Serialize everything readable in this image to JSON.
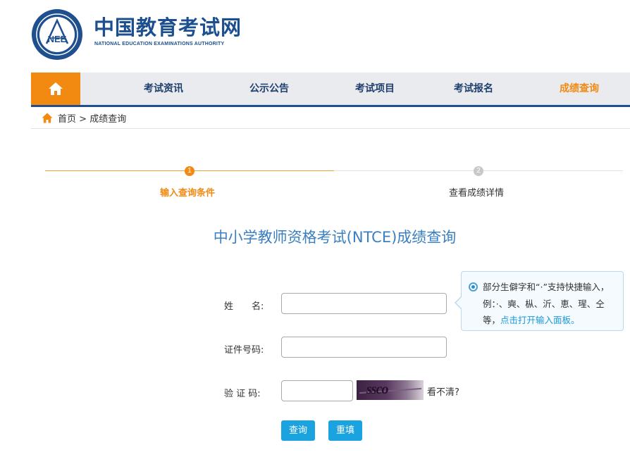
{
  "header": {
    "logo_mark_text": "NEE",
    "title": "中国教育考试网",
    "subtitle": "NATIONAL EDUCATION EXAMINATIONS AUTHORITY"
  },
  "nav": {
    "home_icon": "home-icon",
    "items": [
      {
        "label": "考试资讯"
      },
      {
        "label": "公示公告"
      },
      {
        "label": "考试项目"
      },
      {
        "label": "考试报名"
      },
      {
        "label": "成绩查询",
        "active": true
      }
    ]
  },
  "breadcrumb": {
    "home": "首页",
    "separator": ">",
    "current": "成绩查询"
  },
  "steps": [
    {
      "number": "1",
      "label": "输入查询条件",
      "active": true
    },
    {
      "number": "2",
      "label": "查看成绩详情",
      "active": false
    }
  ],
  "page_title": "中小学教师资格考试(NTCE)成绩查询",
  "form": {
    "name_label": "姓　　名:",
    "name_value": "",
    "id_label": "证件号码:",
    "id_value": "",
    "captcha_label": "验 证 码:",
    "captcha_value": "",
    "captcha_image_text": "ssco",
    "captcha_refresh": "看不清?",
    "submit": "查询",
    "reset": "重填"
  },
  "tip": {
    "text": "部分生僻字和“·”支持快捷输入，例：·、奭、枞、沂、恵、瑆、仝等，",
    "link": "点击打开输入面板。"
  },
  "colors": {
    "brand_blue": "#1e4f8e",
    "accent_orange": "#f28a12",
    "title_blue": "#3a7fc0",
    "button_blue": "#1ba3e0"
  }
}
